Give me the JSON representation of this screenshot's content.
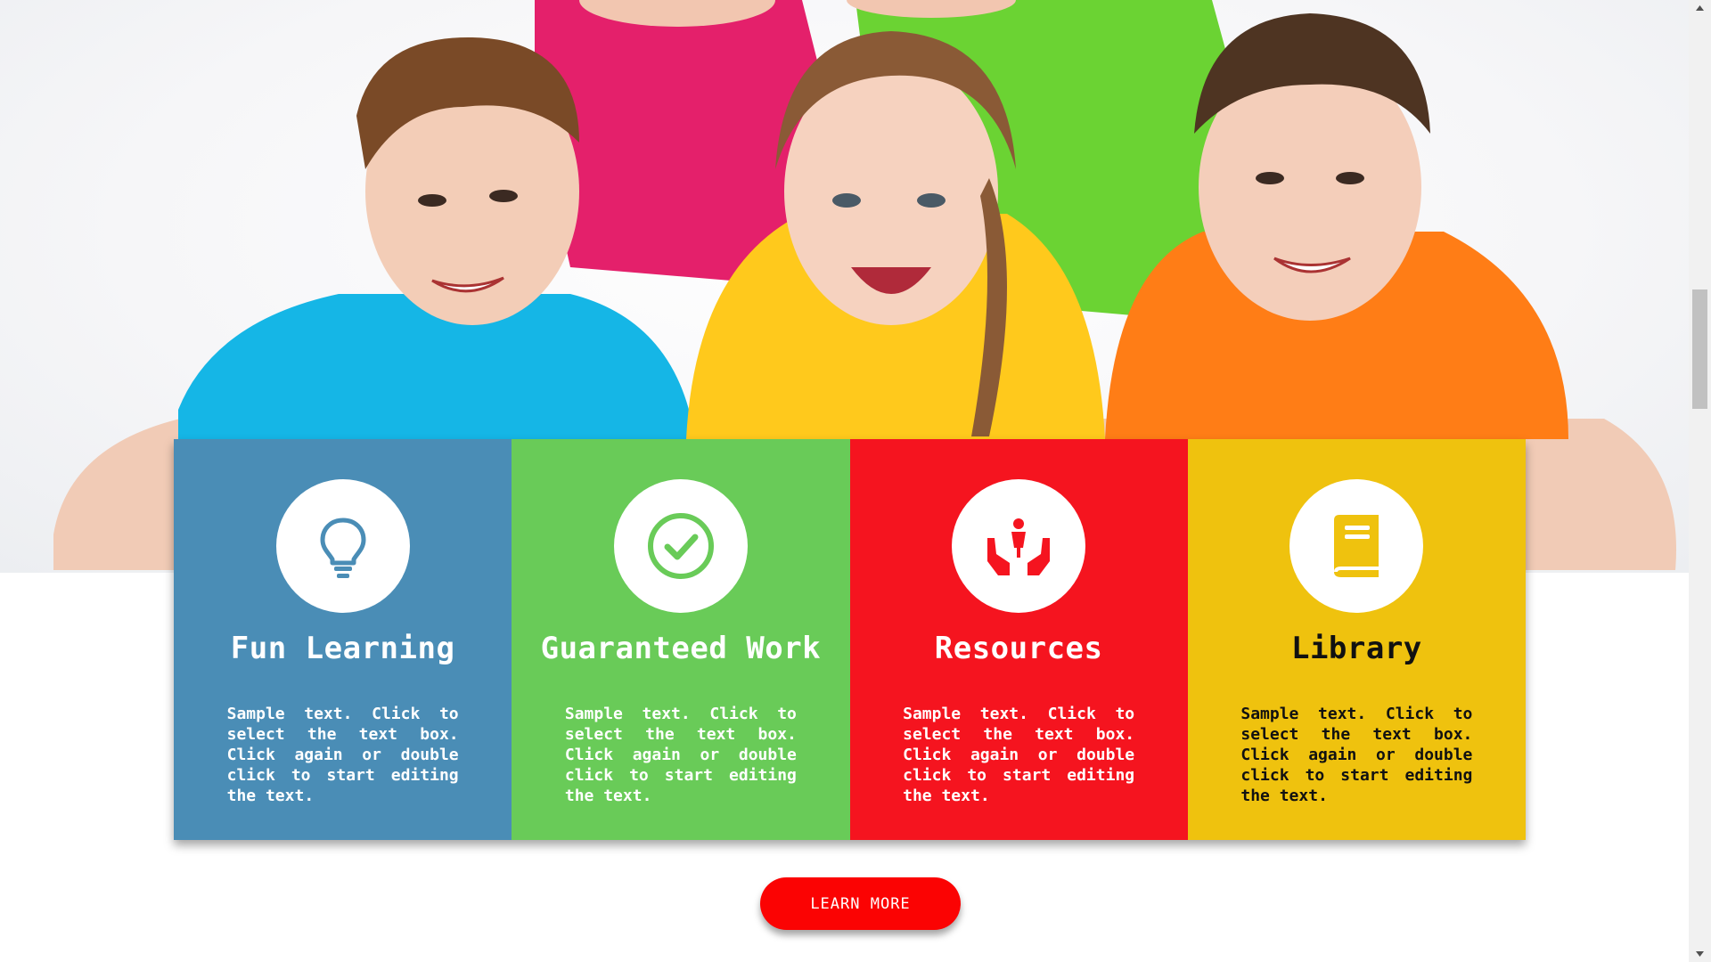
{
  "colors": {
    "card1": "#4a8db6",
    "card2": "#69cb58",
    "card3": "#f5141f",
    "card4": "#efc20e",
    "button": "#fb0303"
  },
  "cards": [
    {
      "icon": "lightbulb-icon",
      "title": "Fun Learning",
      "text": "Sample text. Click to select the text box. Click again or double click to start editing the text."
    },
    {
      "icon": "checkmark-circle-icon",
      "title": "Guaranteed Work",
      "text": "Sample text. Click to select the text box. Click again or double click to start editing the text."
    },
    {
      "icon": "hands-child-icon",
      "title": "Resources",
      "text": "Sample text. Click to select the text box. Click again or double click to start editing the text."
    },
    {
      "icon": "book-icon",
      "title": "Library",
      "text": "Sample text. Click to select the text box. Click again or double click to start editing the text."
    }
  ],
  "button": {
    "label": "LEARN MORE"
  }
}
